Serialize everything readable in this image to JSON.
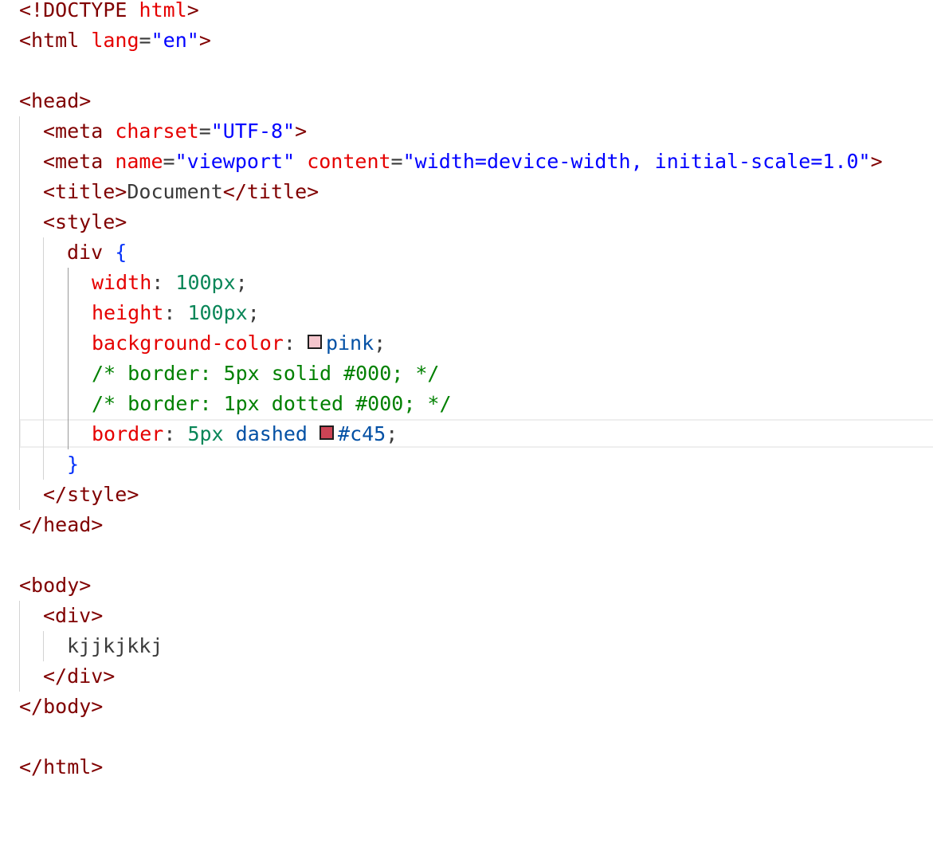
{
  "colors": {
    "pink": "#f4c6cd",
    "c45": "#cc4455"
  },
  "code": {
    "l1": {
      "open": "<!DOCTYPE",
      "name": "html",
      "close": ">"
    },
    "l2": {
      "open": "<html",
      "attr": "lang",
      "eq": "=",
      "val": "\"en\"",
      "close": ">"
    },
    "l4": "<head>",
    "l5": {
      "open": "<meta",
      "attr": "charset",
      "eq": "=",
      "val": "\"UTF-8\"",
      "close": ">"
    },
    "l6": {
      "open": "<meta",
      "attr1": "name",
      "eq1": "=",
      "val1": "\"viewport\"",
      "attr2": "content",
      "eq2": "=",
      "val2": "\"width=device-width, initial-scale=1.0\"",
      "close": ">"
    },
    "l7": {
      "open": "<title>",
      "text": "Document",
      "close": "</title>"
    },
    "l8": "<style>",
    "l9": {
      "selector": "div",
      "brace": "{"
    },
    "l10": {
      "prop": "width",
      "colon": ":",
      "val": "100px",
      "semi": ";"
    },
    "l11": {
      "prop": "height",
      "colon": ":",
      "val": "100px",
      "semi": ";"
    },
    "l12": {
      "prop": "background-color",
      "colon": ":",
      "val": "pink",
      "semi": ";"
    },
    "l13": "/* border: 5px solid #000; */",
    "l14": "/* border: 1px dotted #000; */",
    "l15": {
      "prop": "border",
      "colon": ":",
      "num": "5px",
      "style": "dashed",
      "color": "#c45",
      "semi": ";"
    },
    "l16": "}",
    "l17": "</style>",
    "l18": "</head>",
    "l20": "<body>",
    "l21": "<div>",
    "l22": "kjjkjkkj",
    "l23": "</div>",
    "l24": "</body>",
    "l26": "</html>"
  }
}
